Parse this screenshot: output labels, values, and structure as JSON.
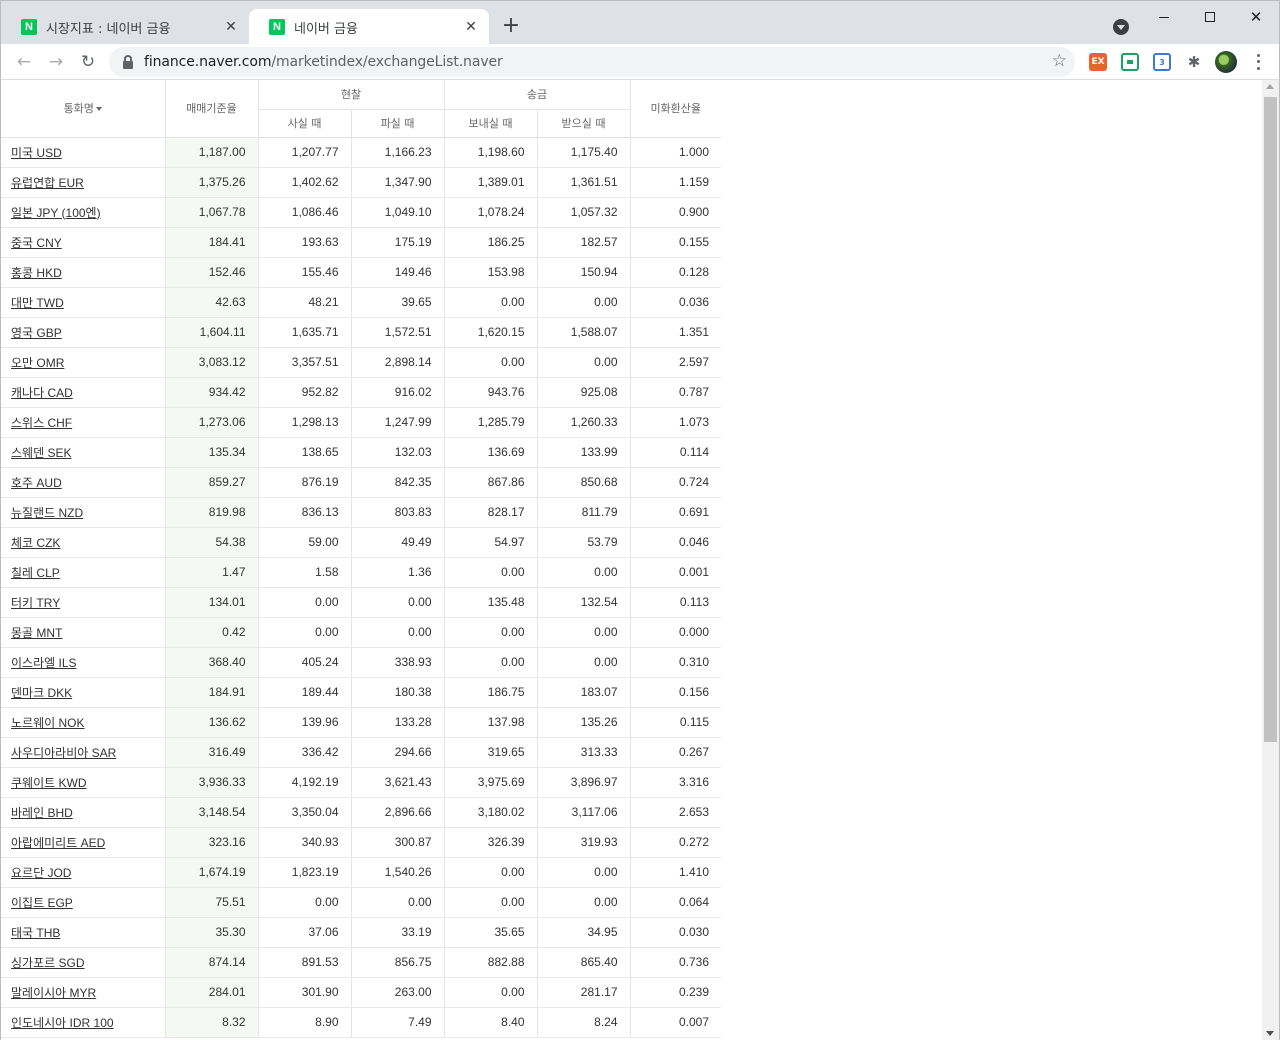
{
  "browser": {
    "tabs": [
      {
        "title": "시장지표 : 네이버 금융",
        "favicon": "N"
      },
      {
        "title": "네이버 금융",
        "favicon": "N"
      }
    ],
    "url_host": "finance.naver.com",
    "url_path": "/marketindex/exchangeList.naver",
    "extensions": {
      "ex_label": "EX",
      "translate_label": "3"
    },
    "icons": {
      "back": "←",
      "forward": "→",
      "reload": "↻",
      "star": "☆",
      "close": "✕",
      "newtab": "+",
      "puzzle": "✱",
      "min": "",
      "max": "",
      "win_close": "✕"
    }
  },
  "table": {
    "header": {
      "name": "통화명",
      "base": "매매기준율",
      "cash": "현찰",
      "remit": "송금",
      "usd_rate": "미화환산율",
      "buy_cash": "사실 때",
      "sell_cash": "파실 때",
      "send": "보내실 때",
      "receive": "받으실 때"
    },
    "rows": [
      {
        "name": "미국 USD",
        "base": "1,187.00",
        "buy": "1,207.77",
        "sell": "1,166.23",
        "send": "1,198.60",
        "receive": "1,175.40",
        "usd": "1.000"
      },
      {
        "name": "유럽연합 EUR",
        "base": "1,375.26",
        "buy": "1,402.62",
        "sell": "1,347.90",
        "send": "1,389.01",
        "receive": "1,361.51",
        "usd": "1.159"
      },
      {
        "name": "일본 JPY (100엔)",
        "base": "1,067.78",
        "buy": "1,086.46",
        "sell": "1,049.10",
        "send": "1,078.24",
        "receive": "1,057.32",
        "usd": "0.900"
      },
      {
        "name": "중국 CNY",
        "base": "184.41",
        "buy": "193.63",
        "sell": "175.19",
        "send": "186.25",
        "receive": "182.57",
        "usd": "0.155"
      },
      {
        "name": "홍콩 HKD",
        "base": "152.46",
        "buy": "155.46",
        "sell": "149.46",
        "send": "153.98",
        "receive": "150.94",
        "usd": "0.128"
      },
      {
        "name": "대만 TWD",
        "base": "42.63",
        "buy": "48.21",
        "sell": "39.65",
        "send": "0.00",
        "receive": "0.00",
        "usd": "0.036"
      },
      {
        "name": "영국 GBP",
        "base": "1,604.11",
        "buy": "1,635.71",
        "sell": "1,572.51",
        "send": "1,620.15",
        "receive": "1,588.07",
        "usd": "1.351"
      },
      {
        "name": "오만 OMR",
        "base": "3,083.12",
        "buy": "3,357.51",
        "sell": "2,898.14",
        "send": "0.00",
        "receive": "0.00",
        "usd": "2.597"
      },
      {
        "name": "캐나다 CAD",
        "base": "934.42",
        "buy": "952.82",
        "sell": "916.02",
        "send": "943.76",
        "receive": "925.08",
        "usd": "0.787"
      },
      {
        "name": "스위스 CHF",
        "base": "1,273.06",
        "buy": "1,298.13",
        "sell": "1,247.99",
        "send": "1,285.79",
        "receive": "1,260.33",
        "usd": "1.073"
      },
      {
        "name": "스웨덴 SEK",
        "base": "135.34",
        "buy": "138.65",
        "sell": "132.03",
        "send": "136.69",
        "receive": "133.99",
        "usd": "0.114"
      },
      {
        "name": "호주 AUD",
        "base": "859.27",
        "buy": "876.19",
        "sell": "842.35",
        "send": "867.86",
        "receive": "850.68",
        "usd": "0.724"
      },
      {
        "name": "뉴질랜드 NZD",
        "base": "819.98",
        "buy": "836.13",
        "sell": "803.83",
        "send": "828.17",
        "receive": "811.79",
        "usd": "0.691"
      },
      {
        "name": "체코 CZK",
        "base": "54.38",
        "buy": "59.00",
        "sell": "49.49",
        "send": "54.97",
        "receive": "53.79",
        "usd": "0.046"
      },
      {
        "name": "칠레 CLP",
        "base": "1.47",
        "buy": "1.58",
        "sell": "1.36",
        "send": "0.00",
        "receive": "0.00",
        "usd": "0.001"
      },
      {
        "name": "터키 TRY",
        "base": "134.01",
        "buy": "0.00",
        "sell": "0.00",
        "send": "135.48",
        "receive": "132.54",
        "usd": "0.113"
      },
      {
        "name": "몽골 MNT",
        "base": "0.42",
        "buy": "0.00",
        "sell": "0.00",
        "send": "0.00",
        "receive": "0.00",
        "usd": "0.000"
      },
      {
        "name": "이스라엘 ILS",
        "base": "368.40",
        "buy": "405.24",
        "sell": "338.93",
        "send": "0.00",
        "receive": "0.00",
        "usd": "0.310"
      },
      {
        "name": "덴마크 DKK",
        "base": "184.91",
        "buy": "189.44",
        "sell": "180.38",
        "send": "186.75",
        "receive": "183.07",
        "usd": "0.156"
      },
      {
        "name": "노르웨이 NOK",
        "base": "136.62",
        "buy": "139.96",
        "sell": "133.28",
        "send": "137.98",
        "receive": "135.26",
        "usd": "0.115"
      },
      {
        "name": "사우디아라비아 SAR",
        "base": "316.49",
        "buy": "336.42",
        "sell": "294.66",
        "send": "319.65",
        "receive": "313.33",
        "usd": "0.267"
      },
      {
        "name": "쿠웨이트 KWD",
        "base": "3,936.33",
        "buy": "4,192.19",
        "sell": "3,621.43",
        "send": "3,975.69",
        "receive": "3,896.97",
        "usd": "3.316"
      },
      {
        "name": "바레인 BHD",
        "base": "3,148.54",
        "buy": "3,350.04",
        "sell": "2,896.66",
        "send": "3,180.02",
        "receive": "3,117.06",
        "usd": "2.653"
      },
      {
        "name": "아랍에미리트 AED",
        "base": "323.16",
        "buy": "340.93",
        "sell": "300.87",
        "send": "326.39",
        "receive": "319.93",
        "usd": "0.272"
      },
      {
        "name": "요르단 JOD",
        "base": "1,674.19",
        "buy": "1,823.19",
        "sell": "1,540.26",
        "send": "0.00",
        "receive": "0.00",
        "usd": "1.410"
      },
      {
        "name": "이집트 EGP",
        "base": "75.51",
        "buy": "0.00",
        "sell": "0.00",
        "send": "0.00",
        "receive": "0.00",
        "usd": "0.064"
      },
      {
        "name": "태국 THB",
        "base": "35.30",
        "buy": "37.06",
        "sell": "33.19",
        "send": "35.65",
        "receive": "34.95",
        "usd": "0.030"
      },
      {
        "name": "싱가포르 SGD",
        "base": "874.14",
        "buy": "891.53",
        "sell": "856.75",
        "send": "882.88",
        "receive": "865.40",
        "usd": "0.736"
      },
      {
        "name": "말레이시아 MYR",
        "base": "284.01",
        "buy": "301.90",
        "sell": "263.00",
        "send": "0.00",
        "receive": "281.17",
        "usd": "0.239"
      },
      {
        "name": "인도네시아 IDR 100",
        "base": "8.32",
        "buy": "8.90",
        "sell": "7.49",
        "send": "8.40",
        "receive": "8.24",
        "usd": "0.007"
      }
    ]
  },
  "colors": {
    "naver_green": "#03c75a",
    "base_column_bg": "#f4f9f4"
  }
}
